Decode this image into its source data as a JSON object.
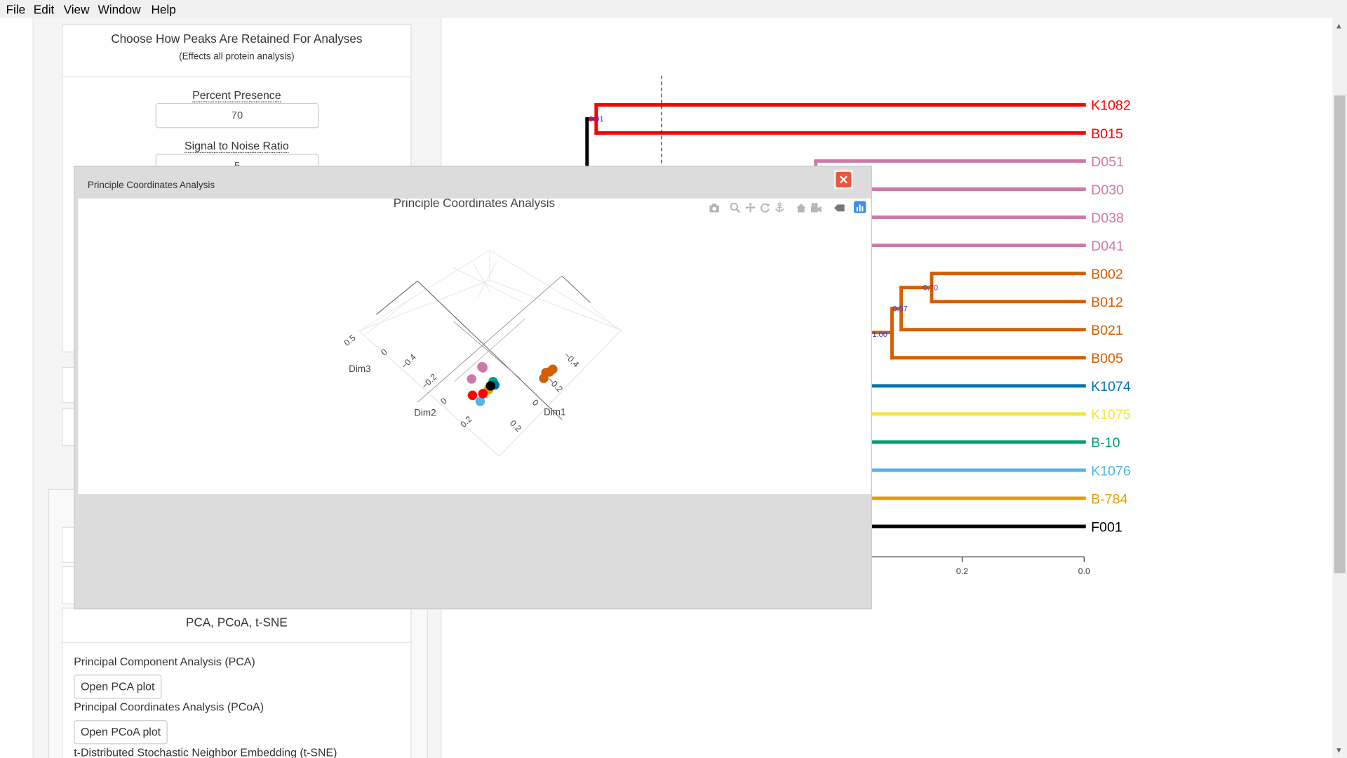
{
  "menu": [
    "File",
    "Edit",
    "View",
    "Window",
    "Help"
  ],
  "peaks_panel": {
    "title": "Choose How Peaks Are Retained For Analyses",
    "subtitle": "(Effects all protein analysis)",
    "percent_presence_label": "Percent Presence",
    "percent_presence_value": "70",
    "snr_label": "Signal to Noise Ratio",
    "snr_value": "5"
  },
  "dr_panel": {
    "title": "PCA, PCoA, t-SNE",
    "pca_label": "Principal Component Analysis (PCA)",
    "pca_button": "Open PCA plot",
    "pcoa_label": "Principal Coordinates Analysis (PCoA)",
    "pcoa_button": "Open PCoA plot",
    "tsne_label": "t-Distributed Stochastic Neighbor Embedding (t-SNE)"
  },
  "modal": {
    "title": "Principle Coordinates Analysis",
    "close_icon": "close-icon"
  },
  "toolbar_icons": [
    "camera-icon",
    "zoom-icon",
    "pan-icon",
    "orbit-icon",
    "turntable-icon",
    "home-icon",
    "camera-reset-icon",
    "hover-icon",
    "plotly-logo-icon"
  ],
  "chart_data": [
    {
      "type": "scatter",
      "title": "Principle Coordinates Analysis",
      "axes": {
        "x": {
          "label": "Dim1",
          "ticks": [
            "−0.4",
            "−0.2",
            "0",
            "0.2"
          ]
        },
        "y": {
          "label": "Dim2",
          "ticks": [
            "−0.4",
            "−0.2",
            "0",
            "0.2"
          ]
        },
        "z": {
          "label": "Dim3",
          "ticks": [
            "0.5",
            "0"
          ]
        }
      },
      "points": [
        {
          "color": "#ede04a",
          "x": -0.35,
          "y": -0.45,
          "z": 0.25
        },
        {
          "color": "#e69f00",
          "x": -0.33,
          "y": -0.43,
          "z": 0.22
        },
        {
          "color": "#009e73",
          "x": -0.2,
          "y": -0.3,
          "z": 0.1
        },
        {
          "color": "#0072b2",
          "x": -0.15,
          "y": -0.25,
          "z": 0.0
        },
        {
          "color": "#56b4e9",
          "x": -0.3,
          "y": -0.3,
          "z": 0.0
        },
        {
          "color": "#ff0000",
          "x": -0.22,
          "y": -0.22,
          "z": -0.05
        },
        {
          "color": "#ff0000",
          "x": -0.25,
          "y": -0.15,
          "z": -0.1
        },
        {
          "color": "#000000",
          "x": 0.0,
          "y": 0.0,
          "z": -0.3
        },
        {
          "color": "#d55e00",
          "x": 0.1,
          "y": -0.45,
          "z": 0.1
        },
        {
          "color": "#d55e00",
          "x": 0.15,
          "y": -0.42,
          "z": 0.05
        },
        {
          "color": "#d55e00",
          "x": 0.12,
          "y": -0.4,
          "z": 0.0
        },
        {
          "color": "#d55e00",
          "x": 0.16,
          "y": -0.44,
          "z": 0.08
        },
        {
          "color": "#cc79a7",
          "x": 0.05,
          "y": 0.15,
          "z": -0.3
        },
        {
          "color": "#cc79a7",
          "x": 0.08,
          "y": 0.2,
          "z": -0.35
        },
        {
          "color": "#cc79a7",
          "x": 0.1,
          "y": 0.22,
          "z": -0.38
        },
        {
          "color": "#cc79a7",
          "x": 0.0,
          "y": 0.2,
          "z": -0.4
        }
      ]
    },
    {
      "type": "dendrogram",
      "xlabel": "",
      "x_ticks": [
        "0.2",
        "0.0"
      ],
      "xlim": [
        0.55,
        0.0
      ],
      "leaves": [
        {
          "label": "K1082",
          "color": "#ff0000"
        },
        {
          "label": "B015",
          "color": "#ff0000"
        },
        {
          "label": "D051",
          "color": "#cc79a7"
        },
        {
          "label": "D030",
          "color": "#cc79a7"
        },
        {
          "label": "D038",
          "color": "#cc79a7"
        },
        {
          "label": "D041",
          "color": "#cc79a7"
        },
        {
          "label": "B002",
          "color": "#d55e00"
        },
        {
          "label": "B012",
          "color": "#d55e00"
        },
        {
          "label": "B021",
          "color": "#d55e00"
        },
        {
          "label": "B005",
          "color": "#d55e00"
        },
        {
          "label": "K1074",
          "color": "#0072b2"
        },
        {
          "label": "K1075",
          "color": "#f0e442"
        },
        {
          "label": "B-10",
          "color": "#009e73"
        },
        {
          "label": "K1076",
          "color": "#56b4e9"
        },
        {
          "label": "B-784",
          "color": "#e69f00"
        },
        {
          "label": "F001",
          "color": "#000000"
        }
      ],
      "node_labels": [
        "0.91",
        "0.70",
        "0.57",
        "1.00"
      ]
    }
  ]
}
